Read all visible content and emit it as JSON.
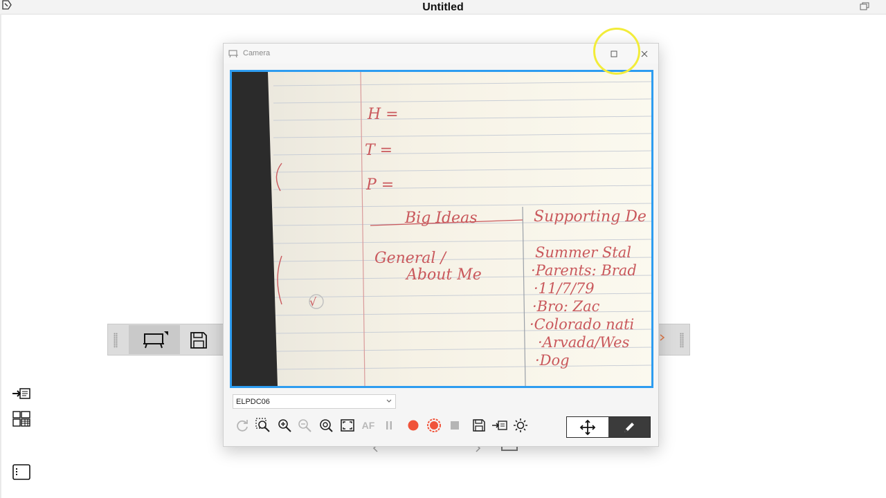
{
  "app": {
    "title": "Untitled"
  },
  "camera_window": {
    "title": "Camera",
    "device": {
      "selected": "ELPDC06"
    },
    "preview": {
      "handwriting": {
        "h_line": "H =",
        "t_line": "T =",
        "p_line": "P =",
        "col1_header": "Big Ideas",
        "col2_header": "Supporting De",
        "col1_item_line1": "General /",
        "col1_item_line2": "About Me",
        "col2_lines": [
          "Summer Stal",
          "·Parents: Brad",
          "·11/7/79",
          "·Bro: Zac",
          "·Colorado nati",
          "·Arvada/Wes",
          "·Dog"
        ],
        "margin_check": "√"
      }
    },
    "toolbar": {
      "af_label": "AF"
    }
  },
  "colors": {
    "preview_border": "#2d9cf0",
    "record_red": "#f0533a",
    "highlight_ring": "#f2ec3a",
    "ink_red": "#c9585c"
  }
}
